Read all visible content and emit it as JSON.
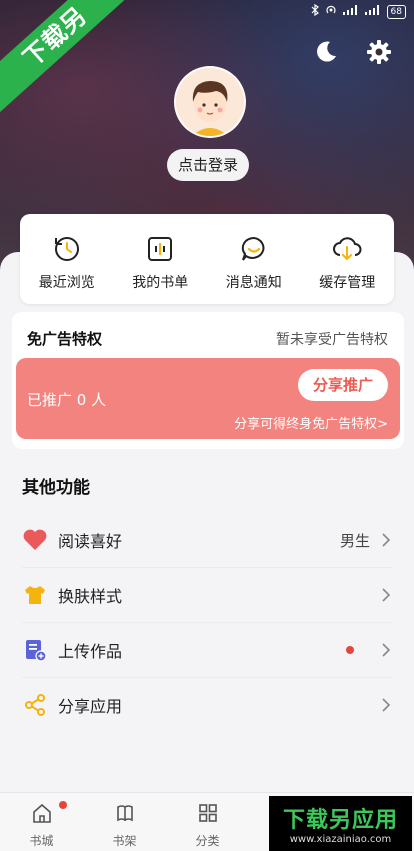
{
  "status_bar": {
    "battery": "68"
  },
  "badge": {
    "text": "下载另"
  },
  "header": {
    "login_label": "点击登录"
  },
  "quick_menu": [
    {
      "label": "最近浏览",
      "icon": "history-icon"
    },
    {
      "label": "我的书单",
      "icon": "booklist-icon"
    },
    {
      "label": "消息通知",
      "icon": "message-icon"
    },
    {
      "label": "缓存管理",
      "icon": "cloud-download-icon"
    }
  ],
  "ad_privilege": {
    "title": "免广告特权",
    "status": "暂未享受广告特权",
    "promoted": "已推广 0 人",
    "share_button": "分享推广",
    "tip": "分享可得终身免广告特权>"
  },
  "other_functions": {
    "title": "其他功能",
    "items": [
      {
        "label": "阅读喜好",
        "value": "男生",
        "icon": "heart-icon"
      },
      {
        "label": "换肤样式",
        "value": "",
        "icon": "shirt-icon"
      },
      {
        "label": "上传作品",
        "value": "",
        "icon": "upload-doc-icon"
      },
      {
        "label": "分享应用",
        "value": "",
        "icon": "share-icon"
      }
    ]
  },
  "bottom_nav": [
    {
      "label": "书城",
      "icon": "home-icon"
    },
    {
      "label": "书架",
      "icon": "bookshelf-icon"
    },
    {
      "label": "分类",
      "icon": "category-icon"
    }
  ],
  "watermark": {
    "main": "下载另应用",
    "sub": "www.xiazainiao.com"
  },
  "colors": {
    "accent": "#f2837e",
    "badge_green": "#2bb24c",
    "icon_yellow": "#f5b40d",
    "heart_red": "#ea5a5a"
  }
}
